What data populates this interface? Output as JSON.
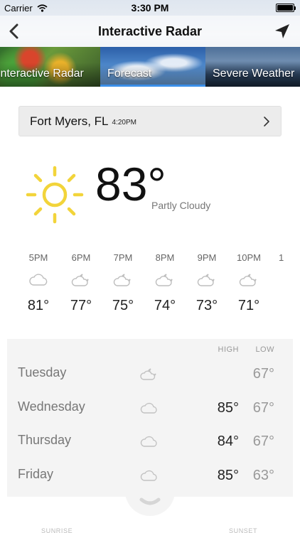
{
  "status_bar": {
    "carrier": "Carrier",
    "time": "3:30 PM"
  },
  "nav": {
    "title": "Interactive Radar",
    "back_icon": "chevron-left-icon",
    "location_icon": "location-arrow-icon"
  },
  "tabs": [
    {
      "label": "Interactive Radar",
      "selected": false
    },
    {
      "label": "Forecast",
      "selected": true
    },
    {
      "label": "Severe Weather",
      "selected": false
    }
  ],
  "location": {
    "city": "Fort Myers, FL",
    "time": "4:20PM"
  },
  "current": {
    "temp": "83°",
    "condition": "Partly Cloudy",
    "icon": "sun-icon"
  },
  "hourly": [
    {
      "time": "5PM",
      "temp": "81°",
      "icon": "cloud-icon"
    },
    {
      "time": "6PM",
      "temp": "77°",
      "icon": "partly-cloudy-night-icon"
    },
    {
      "time": "7PM",
      "temp": "75°",
      "icon": "partly-cloudy-night-icon"
    },
    {
      "time": "8PM",
      "temp": "74°",
      "icon": "partly-cloudy-night-icon"
    },
    {
      "time": "9PM",
      "temp": "73°",
      "icon": "partly-cloudy-night-icon"
    },
    {
      "time": "10PM",
      "temp": "71°",
      "icon": "partly-cloudy-night-icon"
    },
    {
      "time": "1",
      "temp": "",
      "icon": ""
    }
  ],
  "daily": {
    "high_header": "HIGH",
    "low_header": "LOW",
    "days": [
      {
        "day": "Tuesday",
        "high": "",
        "low": "67°",
        "icon": "partly-cloudy-night-icon"
      },
      {
        "day": "Wednesday",
        "high": "85°",
        "low": "67°",
        "icon": "cloud-icon"
      },
      {
        "day": "Thursday",
        "high": "84°",
        "low": "67°",
        "icon": "cloud-icon"
      },
      {
        "day": "Friday",
        "high": "85°",
        "low": "63°",
        "icon": "cloud-icon"
      }
    ]
  },
  "bottom": {
    "sunrise_label": "SUNRISE",
    "sunset_label": "SUNSET"
  },
  "colors": {
    "sun": "#f2d43a",
    "accent": "#3b8fe8",
    "icon_gray": "#bdbdbd"
  }
}
